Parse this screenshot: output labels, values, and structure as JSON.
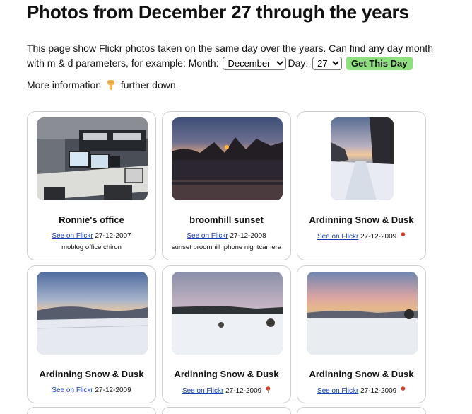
{
  "header": {
    "title": "Photos from December 27 through the years"
  },
  "intro": {
    "line1": "This page show Flickr photos taken on the same day over the years. Can find any day month",
    "line2_prefix": "with m & d parameters, for example: Month:",
    "day_label": "Day:",
    "month_value": "December",
    "day_value": "27",
    "button_label": "Get This Day"
  },
  "more": {
    "text_before": "More information",
    "text_after": "further down.",
    "icon": "pointing-down-hand-icon"
  },
  "cards": [
    {
      "title": "Ronnie's office",
      "link": "See on Flickr",
      "date": "27-12-2007",
      "tags": "moblog office chiron",
      "pin": false
    },
    {
      "title": "broomhill sunset",
      "link": "See on Flickr",
      "date": "27-12-2008",
      "tags": "sunset broomhill iphone nightcamera",
      "pin": false
    },
    {
      "title": "Ardinning Snow & Dusk",
      "link": "See on Flickr",
      "date": "27-12-2009",
      "tags": "",
      "pin": true
    },
    {
      "title": "Ardinning Snow & Dusk",
      "link": "See on Flickr",
      "date": "27-12-2009",
      "tags": "",
      "pin": false
    },
    {
      "title": "Ardinning Snow & Dusk",
      "link": "See on Flickr",
      "date": "27-12-2009",
      "tags": "",
      "pin": true
    },
    {
      "title": "Ardinning Snow & Dusk",
      "link": "See on Flickr",
      "date": "27-12-2009",
      "tags": "",
      "pin": true
    }
  ],
  "colors": {
    "button_bg": "#8ee07e",
    "link": "#1a3fb0",
    "pin": "#e03a2c"
  }
}
